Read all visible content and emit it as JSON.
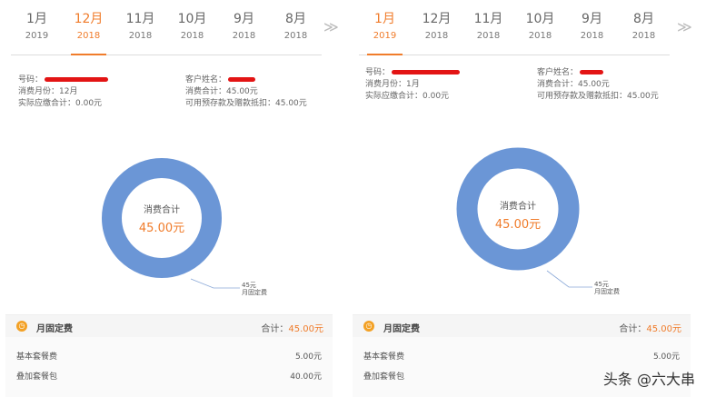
{
  "left": {
    "tabs": [
      {
        "month": "1月",
        "year": "2019"
      },
      {
        "month": "12月",
        "year": "2018"
      },
      {
        "month": "11月",
        "year": "2018"
      },
      {
        "month": "10月",
        "year": "2018"
      },
      {
        "month": "9月",
        "year": "2018"
      },
      {
        "month": "8月",
        "year": "2018"
      }
    ],
    "active_tab": 1,
    "info": {
      "number_label": "号码：",
      "month_label": "消费月份：",
      "month_value": "12月",
      "due_label": "实际应缴合计：",
      "due_value": "0.00元",
      "customer_label": "客户姓名：",
      "total_label": "消费合计：",
      "total_value": "45.00元",
      "prepaid_label": "可用预存款及赠款抵扣：",
      "prepaid_value": "45.00元"
    },
    "donut": {
      "center_title": "消费合计",
      "center_value": "45.00元",
      "leader_amount": "45元",
      "leader_name": "月固定费"
    },
    "fee": {
      "title": "月固定费",
      "total_label": "合计：",
      "total_value": "45.00元",
      "rows": [
        {
          "name": "基本套餐费",
          "amount": "5.00元"
        },
        {
          "name": "叠加套餐包",
          "amount": "40.00元"
        }
      ]
    }
  },
  "right": {
    "tabs": [
      {
        "month": "1月",
        "year": "2019"
      },
      {
        "month": "12月",
        "year": "2018"
      },
      {
        "month": "11月",
        "year": "2018"
      },
      {
        "month": "10月",
        "year": "2018"
      },
      {
        "month": "9月",
        "year": "2018"
      },
      {
        "month": "8月",
        "year": "2018"
      }
    ],
    "active_tab": 0,
    "info": {
      "number_label": "号码：",
      "month_label": "消费月份：",
      "month_value": "1月",
      "due_label": "实际应缴合计：",
      "due_value": "0.00元",
      "customer_label": "客户姓名：",
      "total_label": "消费合计：",
      "total_value": "45.00元",
      "prepaid_label": "可用预存款及赠款抵扣：",
      "prepaid_value": "45.00元"
    },
    "donut": {
      "center_title": "消费合计",
      "center_value": "45.00元",
      "leader_amount": "45元",
      "leader_name": "月固定费"
    },
    "fee": {
      "title": "月固定费",
      "total_label": "合计：",
      "total_value": "45.00元",
      "rows": [
        {
          "name": "基本套餐费",
          "amount": "5.00元"
        },
        {
          "name": "叠加套餐包",
          "amount": ""
        }
      ]
    }
  },
  "chevron": "≫",
  "watermark": "头条 @六大串",
  "colors": {
    "accent": "#f07c2b",
    "ring": "#6b96d6",
    "redaction": "#e31414"
  }
}
